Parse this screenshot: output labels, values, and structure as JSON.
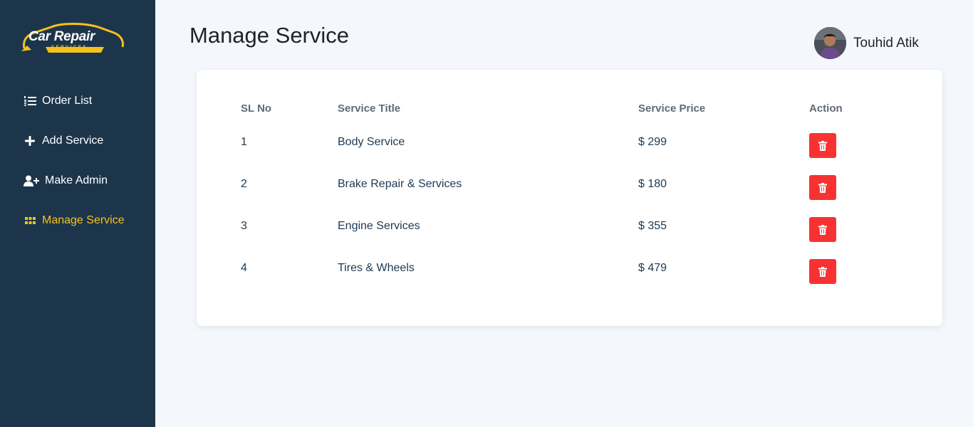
{
  "app": {
    "logo_text": "Car Repair",
    "logo_subtext": "SERVICES",
    "brand_color": "#f6c11c",
    "sidebar_color": "#1d354b"
  },
  "sidebar": {
    "items": [
      {
        "label": "Order List",
        "icon": "ordered-list-icon",
        "active": false
      },
      {
        "label": "Add Service",
        "icon": "plus-icon",
        "active": false
      },
      {
        "label": "Make Admin",
        "icon": "user-plus-icon",
        "active": false
      },
      {
        "label": "Manage Service",
        "icon": "grid-icon",
        "active": true
      }
    ]
  },
  "header": {
    "title": "Manage Service",
    "user_name": "Touhid Atik"
  },
  "table": {
    "columns": [
      "SL No",
      "Service Title",
      "Service Price",
      "Action"
    ],
    "rows": [
      {
        "sl": "1",
        "title": "Body Service",
        "price": "$ 299"
      },
      {
        "sl": "2",
        "title": "Brake Repair & Services",
        "price": "$ 180"
      },
      {
        "sl": "3",
        "title": "Engine Services",
        "price": "$ 355"
      },
      {
        "sl": "4",
        "title": "Tires & Wheels",
        "price": "$ 479"
      }
    ],
    "delete_icon": "trash-icon",
    "delete_color": "#f83232"
  }
}
